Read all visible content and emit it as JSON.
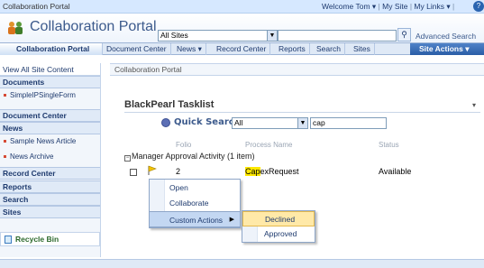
{
  "topbar": {
    "site_name": "Collaboration Portal",
    "welcome": "Welcome Tom",
    "my_site": "My Site",
    "my_links": "My Links",
    "help": "?"
  },
  "header": {
    "title": "Collaboration Portal",
    "scope_value": "All Sites",
    "search_value": "",
    "advanced_search": "Advanced Search"
  },
  "nav": {
    "items": [
      "Collaboration Portal",
      "Document Center",
      "News",
      "Record Center",
      "Reports",
      "Search",
      "Sites"
    ],
    "site_actions": "Site Actions"
  },
  "leftnav": {
    "view_all": "View All Site Content",
    "documents": "Documents",
    "doc_items": [
      "SimpleIPSingleForm"
    ],
    "document_center": "Document Center",
    "news": "News",
    "news_items": [
      "Sample News Article",
      "News Archive"
    ],
    "record_center": "Record Center",
    "reports": "Reports",
    "search": "Search",
    "sites": "Sites",
    "recycle_bin": "Recycle Bin"
  },
  "main": {
    "breadcrumb": "Collaboration Portal",
    "webpart_title": "BlackPearl Tasklist",
    "quick_search_label": "Quick Search:",
    "quick_search_filter": "All",
    "quick_search_value": "cap",
    "columns": [
      "Folio",
      "Process Name",
      "Status"
    ],
    "group_label": "Manager Approval Activity (1 item)",
    "row": {
      "folio": "2",
      "process_highlight": "Cap",
      "process_rest": "exRequest",
      "status": "Available"
    }
  },
  "context_menu": {
    "items": [
      "Open",
      "Collaborate",
      "Custom Actions"
    ],
    "submenu": [
      "Declined",
      "Approved"
    ]
  }
}
